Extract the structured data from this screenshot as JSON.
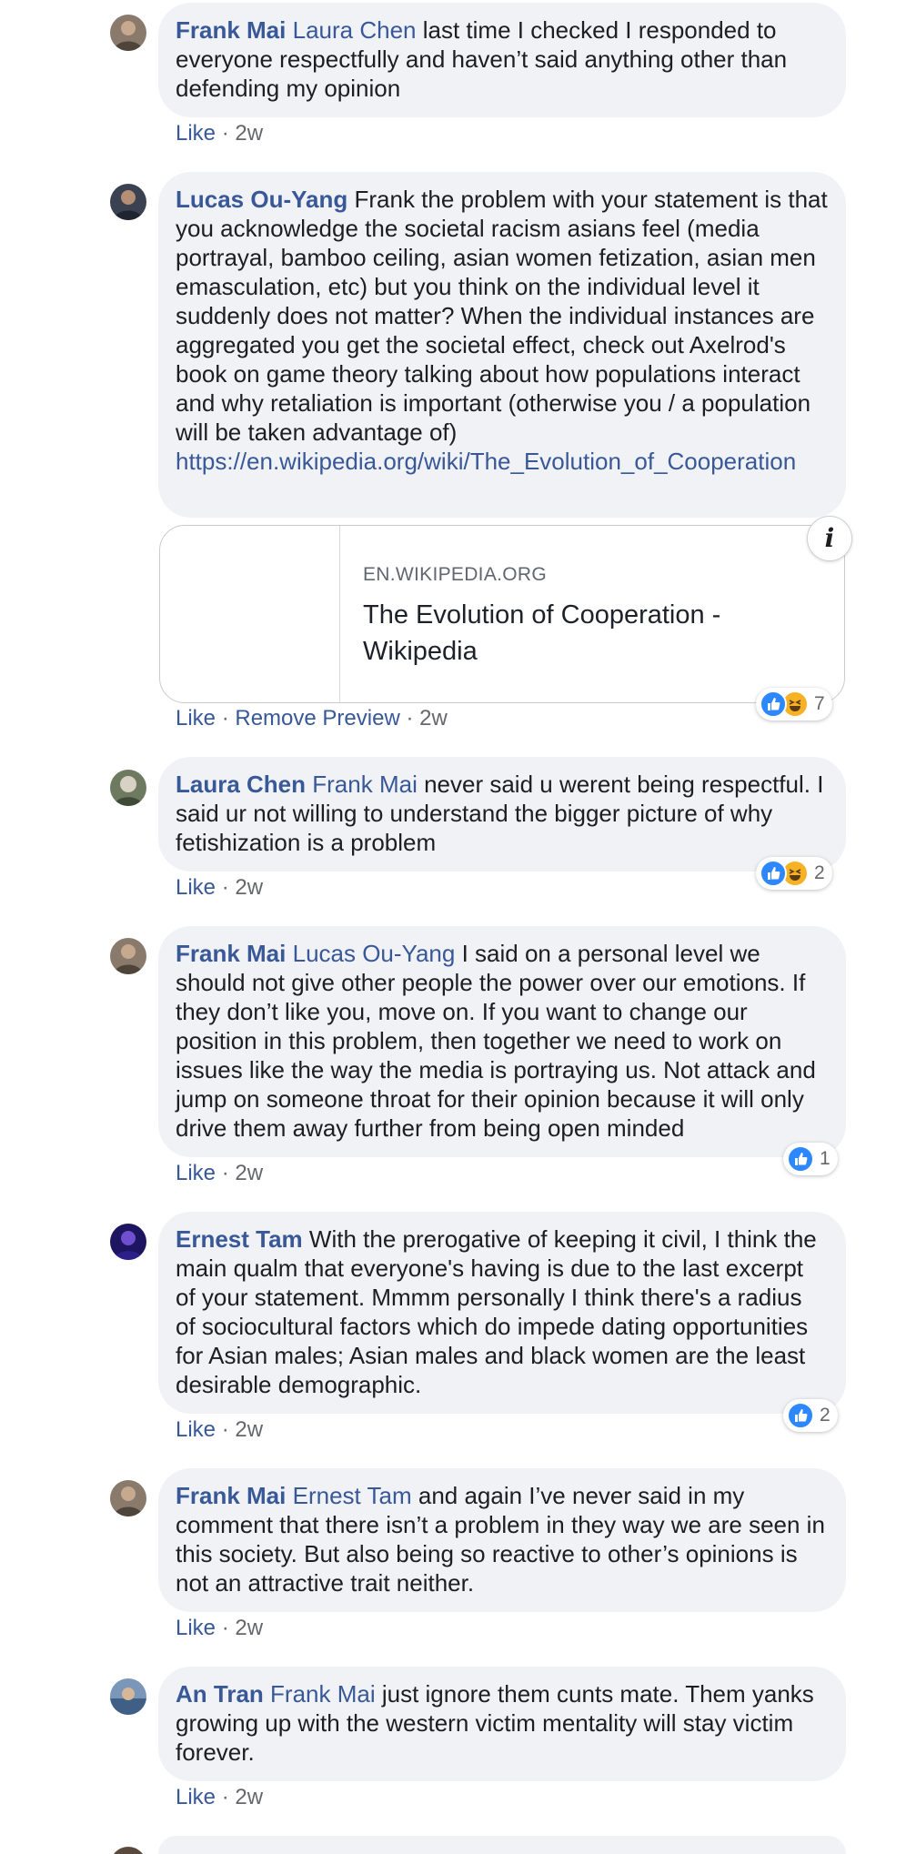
{
  "comments": [
    {
      "author": "Frank Mai",
      "mention": "Laura Chen",
      "text": "last time I checked I responded to everyone respectfully and haven’t said anything other than defending my opinion",
      "like_label": "Like",
      "time": "2w"
    },
    {
      "author": "Lucas Ou-Yang",
      "text": "Frank the problem with your statement is that you acknowledge the societal racism asians feel (media portrayal, bamboo ceiling, asian women fetization, asian men emasculation, etc) but you think on the individual level it suddenly does not matter? When the individual instances are aggregated you get the societal effect, check out Axelrod's book on game theory talking about how populations interact and why retaliation is important (otherwise you / a population will be taken advantage of)",
      "link": "https://en.wikipedia.org/wiki/The_Evolution_of_Cooperation",
      "preview": {
        "domain": "EN.WIKIPEDIA.ORG",
        "title": "The Evolution of Cooperation - Wikipedia",
        "info_glyph": "i"
      },
      "like_label": "Like",
      "remove_preview_label": "Remove Preview",
      "time": "2w",
      "reactions": {
        "icons": [
          "like-icon",
          "haha-icon"
        ],
        "count": "7"
      }
    },
    {
      "author": "Laura Chen",
      "mention": "Frank Mai",
      "text": "never said u werent being respectful. I said ur not willing to understand the bigger picture of why fetishization is a problem",
      "like_label": "Like",
      "time": "2w",
      "reactions": {
        "icons": [
          "like-icon",
          "haha-icon"
        ],
        "count": "2"
      }
    },
    {
      "author": "Frank Mai",
      "mention": "Lucas Ou-Yang",
      "text": "I said on a personal level we should not give other people the power over our emotions. If they don’t like you, move on. If you want to change our position in this problem, then together we need to work on issues like the way the media is portraying us. Not attack and jump on someone throat for their opinion because it will only drive them away further from being open minded",
      "like_label": "Like",
      "time": "2w",
      "reactions": {
        "icons": [
          "like-icon"
        ],
        "count": "1"
      }
    },
    {
      "author": "Ernest Tam",
      "text": "With the prerogative of keeping it civil, I think the main qualm that everyone's having is due to the last excerpt of your statement. Mmmm personally I think there's a radius of sociocultural factors which do impede dating opportunities for Asian males; Asian males and black women are the least desirable demographic.",
      "like_label": "Like",
      "time": "2w",
      "reactions": {
        "icons": [
          "like-icon"
        ],
        "count": "2"
      }
    },
    {
      "author": "Frank Mai",
      "mention": "Ernest Tam",
      "text": "and again I’ve never said in my comment that there isn’t a problem in they way we are seen in this society. But also being so reactive to other’s opinions is not an attractive trait neither.",
      "like_label": "Like",
      "time": "2w"
    },
    {
      "author": "An Tran",
      "mention": "Frank Mai",
      "text": "just ignore them cunts mate. Them yanks growing up with the western victim mentality will stay victim forever.",
      "like_label": "Like",
      "time": "2w"
    }
  ],
  "separator": "·",
  "colors": {
    "link": "#385898",
    "bubble": "#f0f2f5",
    "text": "#1c1e21",
    "meta": "#65676b",
    "like": "#2d88ff",
    "haha": "#f7b125"
  }
}
